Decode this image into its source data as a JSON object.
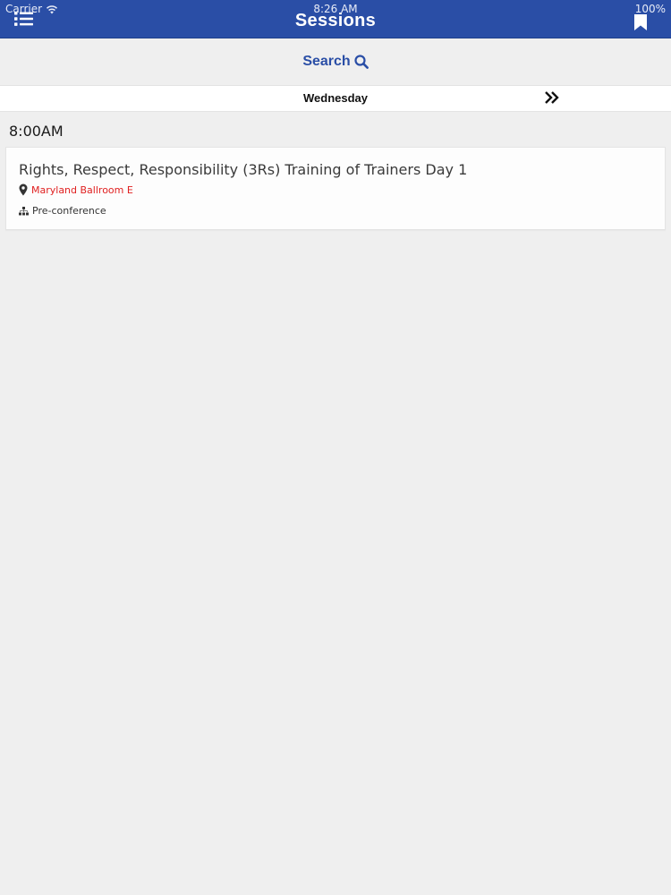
{
  "status_bar": {
    "carrier": "Carrier",
    "time": "8:26 AM",
    "battery": "100%"
  },
  "header": {
    "title": "Sessions"
  },
  "search": {
    "label": "Search"
  },
  "day_nav": {
    "current_day": "Wednesday"
  },
  "schedule": {
    "time_slot": "8:00AM",
    "session": {
      "title": "Rights, Respect, Responsibility (3Rs) Training of Trainers Day 1",
      "location": "Maryland Ballroom E",
      "track": "Pre-conference"
    }
  },
  "colors": {
    "header_bg": "#2a4ea6",
    "accent": "#2a4ea6",
    "location": "#e02020",
    "page_bg": "#efefef"
  },
  "icons": {
    "menu": "list-menu-icon",
    "bookmark": "bookmark-icon",
    "search": "magnifier-icon",
    "next": "double-chevron-right-icon",
    "location": "map-pin-icon",
    "track": "sitemap-icon",
    "wifi": "wifi-icon"
  }
}
